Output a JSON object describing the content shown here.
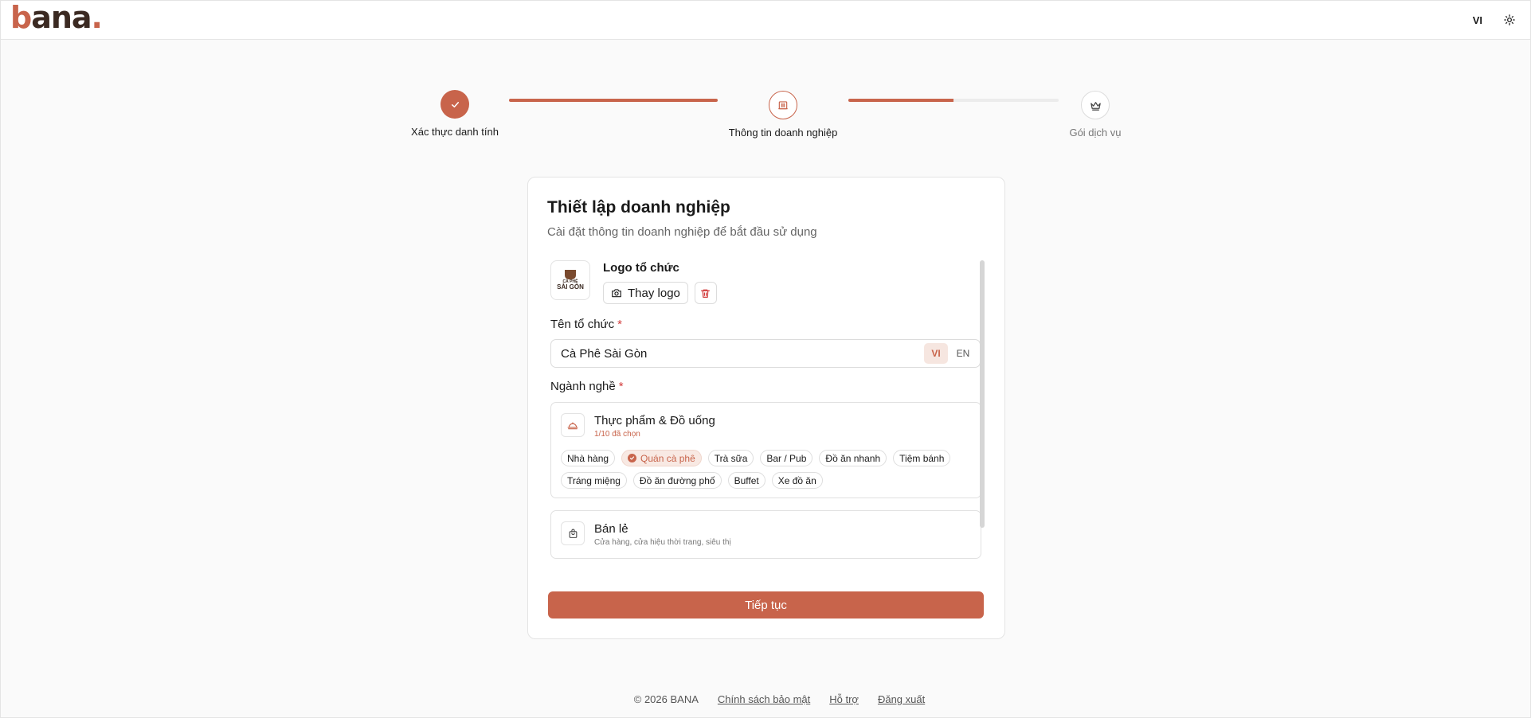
{
  "header": {
    "logo": {
      "b": "b",
      "rest": "ana",
      "dot": "."
    },
    "language": "VI",
    "theme_icon": "sun-icon"
  },
  "stepper": {
    "steps": [
      {
        "label": "Xác thực danh tính",
        "status": "completed",
        "icon": "check-icon"
      },
      {
        "label": "Thông tin doanh nghiệp",
        "status": "current",
        "icon": "building-icon"
      },
      {
        "label": "Gói dịch vụ",
        "status": "pending",
        "icon": "crown-icon"
      }
    ],
    "connector_progress": [
      1.0,
      0.5
    ]
  },
  "card": {
    "title": "Thiết lập doanh nghiệp",
    "subtitle": "Cài đặt thông tin doanh nghiệp để bắt đầu sử dụng",
    "logo_section": {
      "title": "Logo tổ chức",
      "change_label": "Thay logo",
      "logo_text_small": "CÀ PHÊ",
      "logo_text_big": "SÀI GÒN"
    },
    "org_name": {
      "label": "Tên tổ chức",
      "required_mark": "*",
      "value": "Cà Phê Sài Gòn",
      "lang_tabs": [
        "VI",
        "EN"
      ],
      "active_lang": "VI"
    },
    "industry": {
      "label": "Ngành nghề",
      "required_mark": "*",
      "groups": [
        {
          "name": "Thực phẩm & Đồ uống",
          "meta": "1/10 đã chọn",
          "icon": "food-cloche-icon",
          "chips": [
            {
              "label": "Nhà hàng",
              "selected": false
            },
            {
              "label": "Quán cà phê",
              "selected": true
            },
            {
              "label": "Trà sữa",
              "selected": false
            },
            {
              "label": "Bar / Pub",
              "selected": false
            },
            {
              "label": "Đồ ăn nhanh",
              "selected": false
            },
            {
              "label": "Tiệm bánh",
              "selected": false
            },
            {
              "label": "Tráng miệng",
              "selected": false
            },
            {
              "label": "Đồ ăn đường phố",
              "selected": false
            },
            {
              "label": "Buffet",
              "selected": false
            },
            {
              "label": "Xe đồ ăn",
              "selected": false
            }
          ]
        },
        {
          "name": "Bán lẻ",
          "meta": "Cửa hàng, cửa hiệu thời trang, siêu thị",
          "icon": "shopping-bag-icon"
        }
      ]
    },
    "continue_label": "Tiếp tục"
  },
  "footer": {
    "copyright": "© 2026 BANA",
    "links": [
      "Chính sách bảo mật",
      "Hỗ trợ",
      "Đăng xuất"
    ]
  },
  "colors": {
    "accent": "#c8644b",
    "accent_soft": "#f8e9e3",
    "required": "#d23b3b"
  }
}
